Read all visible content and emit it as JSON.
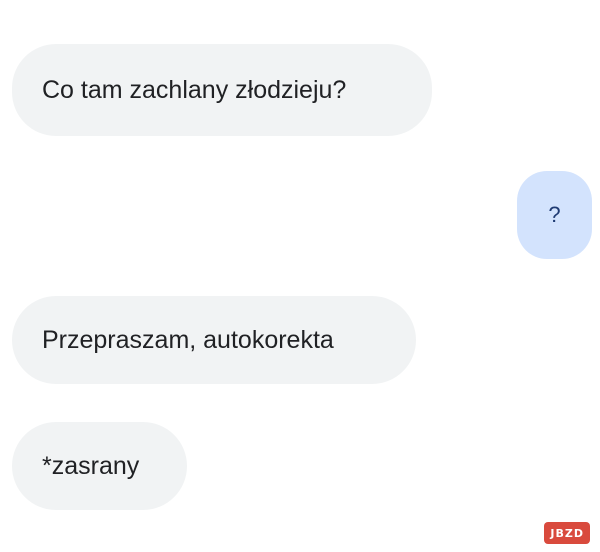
{
  "messages": [
    {
      "direction": "incoming",
      "text": "Co tam zachlany złodzieju?"
    },
    {
      "direction": "outgoing",
      "text": "?"
    },
    {
      "direction": "incoming",
      "text": "Przepraszam, autokorekta"
    },
    {
      "direction": "incoming",
      "text": "*zasrany"
    }
  ],
  "watermark": {
    "text": "JBZD"
  },
  "colors": {
    "incoming_bubble": "#f1f3f4",
    "outgoing_bubble": "#d3e3fd",
    "watermark_bg": "#d94a3d"
  }
}
